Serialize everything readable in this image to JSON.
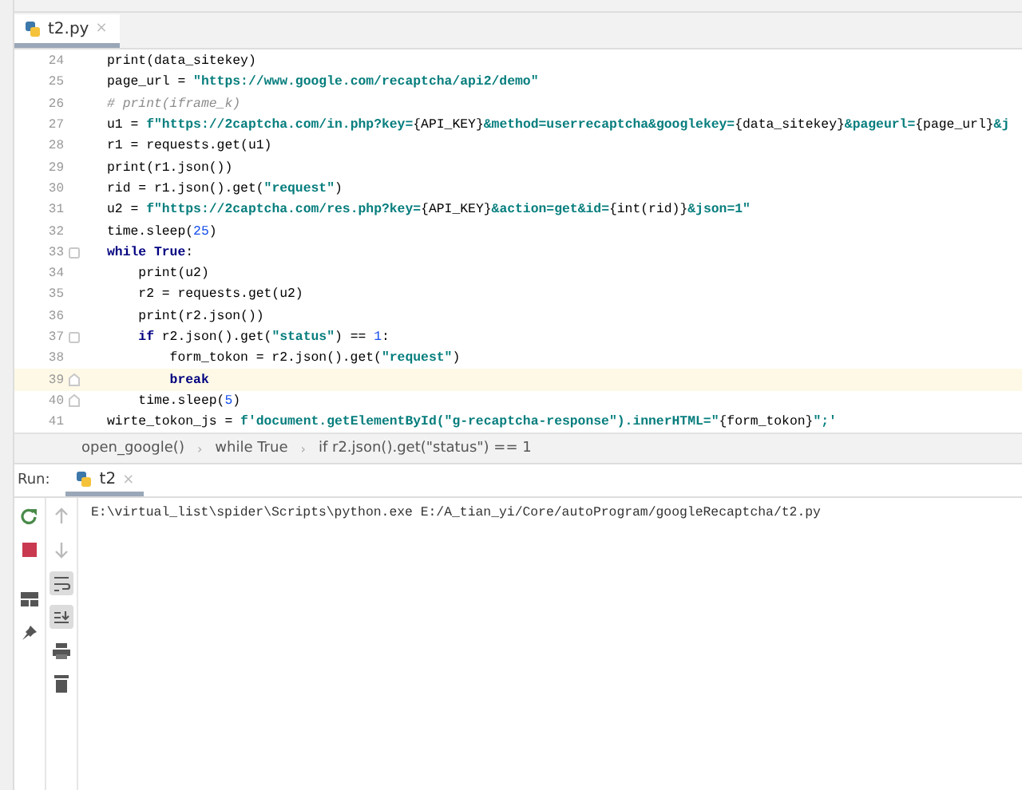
{
  "editor_tab": {
    "label": "t2.py",
    "close": "×",
    "selected": true
  },
  "code_lines": [
    {
      "number": "24",
      "current": false,
      "fold_start": false,
      "fold_end": false,
      "segments": [
        {
          "kind": "code",
          "text": "print(data_sitekey)"
        }
      ]
    },
    {
      "number": "25",
      "current": false,
      "fold_start": false,
      "fold_end": false,
      "segments": [
        {
          "kind": "code",
          "text": "page_url = "
        },
        {
          "kind": "str",
          "text": "\"https://www.google.com/recaptcha/api2/demo\""
        }
      ]
    },
    {
      "number": "26",
      "current": false,
      "fold_start": false,
      "fold_end": false,
      "segments": [
        {
          "kind": "comment",
          "text": "# print(iframe_k)"
        }
      ]
    },
    {
      "number": "27",
      "current": false,
      "fold_start": false,
      "fold_end": false,
      "segments": [
        {
          "kind": "code",
          "text": "u1 = "
        },
        {
          "kind": "str",
          "text": "f\"https://2captcha.com/in.php?key="
        },
        {
          "kind": "code",
          "text": "{API_KEY}"
        },
        {
          "kind": "str",
          "text": "&method=userrecaptcha&googlekey="
        },
        {
          "kind": "code",
          "text": "{data_sitekey}"
        },
        {
          "kind": "str",
          "text": "&pageurl="
        },
        {
          "kind": "code",
          "text": "{page_url}"
        },
        {
          "kind": "str",
          "text": "&j"
        }
      ]
    },
    {
      "number": "28",
      "current": false,
      "fold_start": false,
      "fold_end": false,
      "segments": [
        {
          "kind": "code",
          "text": "r1 = requests.get(u1)"
        }
      ]
    },
    {
      "number": "29",
      "current": false,
      "fold_start": false,
      "fold_end": false,
      "segments": [
        {
          "kind": "code",
          "text": "print(r1.json())"
        }
      ]
    },
    {
      "number": "30",
      "current": false,
      "fold_start": false,
      "fold_end": false,
      "segments": [
        {
          "kind": "code",
          "text": "rid = r1.json().get("
        },
        {
          "kind": "str",
          "text": "\"request\""
        },
        {
          "kind": "code",
          "text": ")"
        }
      ]
    },
    {
      "number": "31",
      "current": false,
      "fold_start": false,
      "fold_end": false,
      "segments": [
        {
          "kind": "code",
          "text": "u2 = "
        },
        {
          "kind": "str",
          "text": "f\"https://2captcha.com/res.php?key="
        },
        {
          "kind": "code",
          "text": "{API_KEY}"
        },
        {
          "kind": "str",
          "text": "&action=get&id="
        },
        {
          "kind": "code",
          "text": "{int(rid)}"
        },
        {
          "kind": "str",
          "text": "&json=1\""
        }
      ]
    },
    {
      "number": "32",
      "current": false,
      "fold_start": false,
      "fold_end": false,
      "segments": [
        {
          "kind": "code",
          "text": "time.sleep("
        },
        {
          "kind": "num",
          "text": "25"
        },
        {
          "kind": "code",
          "text": ")"
        }
      ]
    },
    {
      "number": "33",
      "current": false,
      "fold_start": true,
      "fold_end": false,
      "segments": [
        {
          "kind": "kw",
          "text": "while True"
        },
        {
          "kind": "code",
          "text": ":"
        }
      ]
    },
    {
      "number": "34",
      "current": false,
      "fold_start": false,
      "fold_end": false,
      "segments": [
        {
          "kind": "code",
          "text": "    print(u2)"
        }
      ]
    },
    {
      "number": "35",
      "current": false,
      "fold_start": false,
      "fold_end": false,
      "segments": [
        {
          "kind": "code",
          "text": "    r2 = requests.get(u2)"
        }
      ]
    },
    {
      "number": "36",
      "current": false,
      "fold_start": false,
      "fold_end": false,
      "segments": [
        {
          "kind": "code",
          "text": "    print(r2.json())"
        }
      ]
    },
    {
      "number": "37",
      "current": false,
      "fold_start": true,
      "fold_end": false,
      "segments": [
        {
          "kind": "kw",
          "text": "    if"
        },
        {
          "kind": "code",
          "text": " r2.json().get("
        },
        {
          "kind": "str",
          "text": "\"status\""
        },
        {
          "kind": "code",
          "text": ") == "
        },
        {
          "kind": "num",
          "text": "1"
        },
        {
          "kind": "code",
          "text": ":"
        }
      ]
    },
    {
      "number": "38",
      "current": false,
      "fold_start": false,
      "fold_end": false,
      "segments": [
        {
          "kind": "code",
          "text": "        form_tokon = r2.json().get("
        },
        {
          "kind": "str",
          "text": "\"request\""
        },
        {
          "kind": "code",
          "text": ")"
        }
      ]
    },
    {
      "number": "39",
      "current": true,
      "fold_start": false,
      "fold_end": true,
      "segments": [
        {
          "kind": "kw",
          "text": "        break"
        }
      ]
    },
    {
      "number": "40",
      "current": false,
      "fold_start": false,
      "fold_end": true,
      "segments": [
        {
          "kind": "code",
          "text": "    time.sleep("
        },
        {
          "kind": "num",
          "text": "5"
        },
        {
          "kind": "code",
          "text": ")"
        }
      ]
    },
    {
      "number": "41",
      "current": false,
      "fold_start": false,
      "fold_end": false,
      "segments": [
        {
          "kind": "code",
          "text": "wirte_tokon_js = "
        },
        {
          "kind": "str",
          "text": "f'document.getElementById(\"g-recaptcha-response\").innerHTML=\""
        },
        {
          "kind": "code",
          "text": "{form_tokon}"
        },
        {
          "kind": "str",
          "text": "\";'"
        }
      ]
    }
  ],
  "breadcrumbs": [
    {
      "text": "open_google()"
    },
    {
      "separator": "›",
      "text": "while True"
    },
    {
      "separator": "›",
      "text": "if r2.json().get(\"status\") == 1"
    }
  ],
  "run_panel": {
    "label": "Run:",
    "tab": {
      "label": "t2",
      "close": "×",
      "selected": true
    },
    "soft_wrap_on": true,
    "scroll_to_end_on": true,
    "output": [
      "E:\\virtual_list\\spider\\Scripts\\python.exe E:/A_tian_yi/Core/autoProgram/googleRecaptcha/t2.py"
    ]
  }
}
